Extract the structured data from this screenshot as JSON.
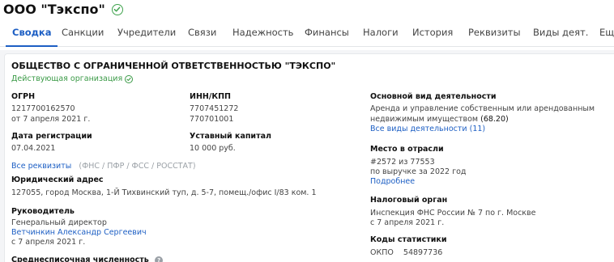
{
  "header": {
    "title": "ООО \"Тэкспо\""
  },
  "tabs": [
    {
      "label": "Сводка",
      "active": true
    },
    {
      "label": "Санкции"
    },
    {
      "label": "Учредители"
    },
    {
      "label": "Связи"
    },
    {
      "label": "Надежность"
    },
    {
      "label": "Финансы"
    },
    {
      "label": "Налоги"
    },
    {
      "label": "История"
    },
    {
      "label": "Реквизиты"
    },
    {
      "label": "Виды деят."
    },
    {
      "label": "Еще"
    }
  ],
  "card": {
    "full_name": "ОБЩЕСТВО С ОГРАНИЧЕННОЙ ОТВЕТСТВЕННОСТЬЮ \"ТЭКСПО\"",
    "status": "Действующая организация",
    "ogrn": {
      "label": "ОГРН",
      "value": "1217700162570",
      "date": "от 7 апреля 2021 г."
    },
    "inn_kpp": {
      "label": "ИНН/КПП",
      "inn": "7707451272",
      "kpp": "770701001"
    },
    "reg_date": {
      "label": "Дата регистрации",
      "value": "07.04.2021"
    },
    "capital": {
      "label": "Уставный капитал",
      "value": "10 000 руб."
    },
    "requisites": {
      "link": "Все реквизиты",
      "sources": "(ФНС / ПФР / ФСС / РОССТАТ)"
    },
    "address": {
      "label": "Юридический адрес",
      "value": "127055, город Москва, 1-Й Тихвинский туп, д. 5-7, помещ./офис I/83 ком. 1"
    },
    "manager": {
      "label": "Руководитель",
      "position": "Генеральный директор",
      "name": "Ветчинкин Александр Сергеевич",
      "date": "с 7 апреля 2021 г."
    },
    "employees": {
      "label": "Среднесписочная численность"
    },
    "activity": {
      "label": "Основной вид деятельности",
      "line1": "Аренда и управление собственным или арендованным",
      "line2": "недвижимым имуществом",
      "code": "(68.20)",
      "link": "Все виды деятельности (11)"
    },
    "industry": {
      "label": "Место в отрасли",
      "rank": "#2572 из 77553",
      "basis": "по выручке за 2022 год",
      "link": "Подробнее"
    },
    "tax": {
      "label": "Налоговый орган",
      "value": "Инспекция ФНС России № 7 по г. Москве",
      "date": "с 7 апреля 2021 г."
    },
    "stats": {
      "label": "Коды статистики",
      "okpo": "ОКПО    54897736"
    }
  },
  "colors": {
    "accent": "#1d5fc4",
    "status_green": "#3a9a46",
    "muted": "#9aa0a6"
  }
}
